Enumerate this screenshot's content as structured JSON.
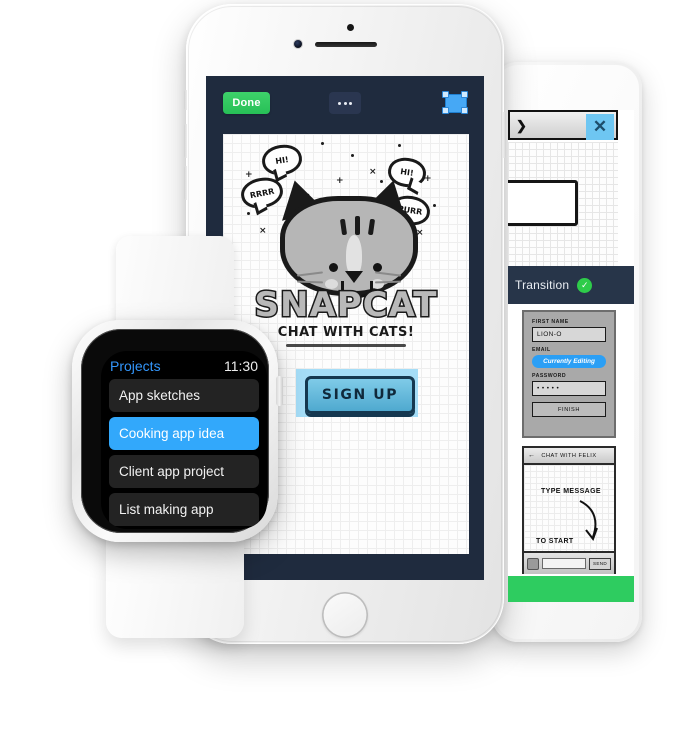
{
  "scene": {
    "description": "App prototyping mockup shown on three devices"
  },
  "right_device": {
    "name": "phablet",
    "toolbar": {
      "back_icon": "back-arrow-icon",
      "close_label": "✕"
    },
    "transition_bar": {
      "label": "Transition",
      "status_icon": "check-circle-icon",
      "status_color": "#2ecc4a"
    },
    "form": {
      "fields": [
        {
          "label": "FIRST NAME",
          "value": "LION-O"
        },
        {
          "label": "EMAIL",
          "value": "",
          "badge": "Currently Editing"
        },
        {
          "label": "PASSWORD",
          "value": "• • • • •"
        }
      ],
      "submit_label": "FINISH"
    },
    "chat": {
      "header_title": "CHAT WITH FELIX",
      "back_icon": "back-arrow-icon",
      "hint_line1": "TYPE MESSAGE",
      "hint_line2": "TO START",
      "camera_icon": "camera-icon",
      "input_placeholder": "",
      "send_label": "SEND"
    },
    "footer_color": "#2ecc60"
  },
  "iphone": {
    "hardware": {
      "camera_icon": "front-camera-icon",
      "sensor_icon": "proximity-sensor-icon",
      "speaker_icon": "earpiece-speaker-icon",
      "home_button_icon": "home-button-icon"
    },
    "toolbar": {
      "done_label": "Done",
      "done_color": "#2ec45a",
      "more_icon": "ellipsis-icon",
      "select_icon": "selection-handles-icon",
      "select_color": "#46a8f5",
      "bar_color": "#1f2b3e"
    },
    "canvas": {
      "artboard_name": "snapcat-signup",
      "speech_bubbles": [
        "HI!",
        "RRRR",
        "HI!",
        "PURR"
      ],
      "sparkles": [
        "+",
        "×",
        "+",
        "×",
        "+",
        "×",
        "+"
      ],
      "brand_title": "SNAPCAT",
      "tagline": "CHAT WITH CATS!",
      "signup_label": "SIGN UP",
      "signup_selection_color": "#a5ddf7"
    }
  },
  "watch": {
    "header": {
      "title": "Projects",
      "title_color": "#3396fb",
      "time": "11:30"
    },
    "list": [
      {
        "label": "App sketches",
        "selected": false
      },
      {
        "label": "Cooking app idea",
        "selected": true
      },
      {
        "label": "Client app project",
        "selected": false
      },
      {
        "label": "List making app",
        "selected": false
      }
    ],
    "selected_color": "#32a8fb",
    "crown_icon": "digital-crown-icon"
  }
}
